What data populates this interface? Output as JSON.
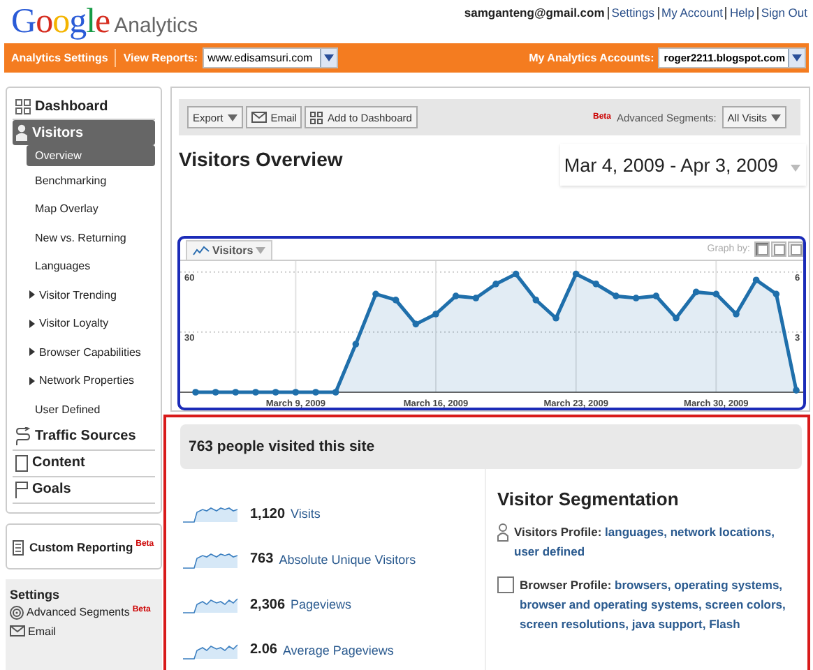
{
  "header": {
    "logo": {
      "brand": "Google",
      "product": "Analytics"
    },
    "user_email": "samganteng@gmail.com",
    "links": [
      "Settings",
      "My Account",
      "Help",
      "Sign Out"
    ]
  },
  "nav_bar": {
    "settings_link": "Analytics Settings",
    "view_reports_label": "View Reports:",
    "view_reports_value": "www.edisamsuri.com",
    "accounts_label": "My Analytics Accounts:",
    "accounts_value": "roger2211.blogspot.com"
  },
  "sidebar": {
    "sections": [
      {
        "label": "Dashboard",
        "selected": false
      },
      {
        "label": "Visitors",
        "selected": true,
        "children": [
          {
            "label": "Overview",
            "selected": true,
            "kind": "link"
          },
          {
            "label": "Benchmarking",
            "selected": false,
            "kind": "link"
          },
          {
            "label": "Map Overlay",
            "selected": false,
            "kind": "link"
          },
          {
            "label": "New vs. Returning",
            "selected": false,
            "kind": "link"
          },
          {
            "label": "Languages",
            "selected": false,
            "kind": "link"
          },
          {
            "label": "Visitor Trending",
            "selected": false,
            "kind": "group"
          },
          {
            "label": "Visitor Loyalty",
            "selected": false,
            "kind": "group"
          },
          {
            "label": "Browser Capabilities",
            "selected": false,
            "kind": "group"
          },
          {
            "label": "Network Properties",
            "selected": false,
            "kind": "group"
          },
          {
            "label": "User Defined",
            "selected": false,
            "kind": "link"
          }
        ]
      },
      {
        "label": "Traffic Sources",
        "selected": false
      },
      {
        "label": "Content",
        "selected": false
      },
      {
        "label": "Goals",
        "selected": false
      }
    ],
    "custom_reporting": {
      "label": "Custom Reporting",
      "badge": "Beta"
    },
    "settings": {
      "title": "Settings",
      "items": [
        {
          "label": "Advanced Segments",
          "badge": "Beta"
        },
        {
          "label": "Email"
        }
      ]
    }
  },
  "toolbar": {
    "buttons": [
      "Export",
      "Email",
      "Add to Dashboard"
    ],
    "segments_badge": "Beta",
    "segments_label": "Advanced Segments:",
    "segments_value": "All Visits"
  },
  "report": {
    "title": "Visitors Overview",
    "date_range": "Mar 4, 2009 - Apr 3, 2009"
  },
  "graph": {
    "graph_by_label": "Graph by:",
    "graph_by_options": [
      {
        "selected": true
      },
      {
        "selected": false
      },
      {
        "selected": false
      }
    ],
    "right_axis_labels": [
      "6",
      "3"
    ],
    "chart_data": {
      "type": "area",
      "categories": [
        null,
        null,
        null,
        null,
        null,
        "March 9, 2009",
        null,
        null,
        null,
        null,
        null,
        null,
        "March 16, 2009",
        null,
        null,
        null,
        null,
        null,
        null,
        "March 23, 2009",
        null,
        null,
        null,
        null,
        null,
        null,
        "March 30, 2009",
        null,
        null,
        null,
        null
      ],
      "series": [
        {
          "name": "Visitors",
          "color": "#1f6fab",
          "values": [
            0,
            0,
            0,
            0,
            0,
            0,
            0,
            0,
            24,
            49,
            46,
            34,
            39,
            48,
            47,
            54,
            59,
            46,
            37,
            59,
            54,
            48,
            47,
            48,
            37,
            50,
            49,
            39,
            56,
            49,
            1
          ]
        }
      ],
      "ylim": [
        0,
        78
      ],
      "yticks": [
        30,
        60
      ],
      "grid": true
    }
  },
  "summary": {
    "headline": "763 people visited this site",
    "metrics": [
      {
        "value": "1,120",
        "label": "Visits"
      },
      {
        "value": "763",
        "label": "Absolute Unique Visitors"
      },
      {
        "value": "2,306",
        "label": "Pageviews"
      },
      {
        "value": "2.06",
        "label": "Average Pageviews"
      }
    ],
    "segmentation": {
      "title": "Visitor Segmentation",
      "profiles": [
        {
          "label": "Visitors Profile:",
          "links": [
            "languages,",
            "network locations,",
            "user defined"
          ]
        },
        {
          "label": "Browser Profile:",
          "links": [
            "browsers,",
            "operating systems,",
            "browser and operating systems,",
            "screen colors,",
            "screen resolutions,",
            "java support,",
            "Flash"
          ]
        }
      ]
    }
  }
}
